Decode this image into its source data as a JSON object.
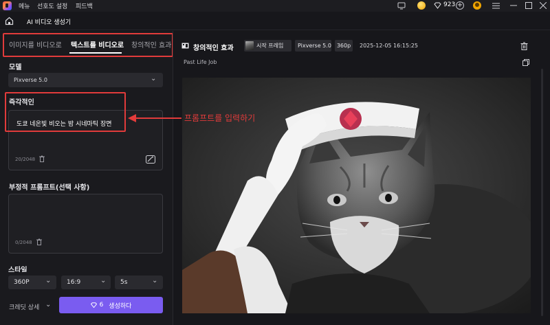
{
  "topbar": {
    "menu": "메뉴",
    "preferences": "선호도 설정",
    "feedback": "피드백",
    "credits": "923"
  },
  "header": {
    "title": "AI 비디오 생성기"
  },
  "left": {
    "tabs": [
      {
        "label": "이미지를 비디오로",
        "active": false
      },
      {
        "label": "텍스트를 비디오로",
        "active": true
      },
      {
        "label": "창의적인 효과",
        "active": false
      }
    ],
    "model_label": "모델",
    "model_value": "Pixverse 5.0",
    "prompt_label": "즉각적인",
    "prompt_text": "도쿄 네온빛 비오는 밤 시네마틱 장면",
    "prompt_count": "20/2048",
    "negative_label": "부정적 프롬프트(선택 사항)",
    "negative_count": "0/2048",
    "style_label": "스타일",
    "options": {
      "resolution": "360P",
      "aspect": "16:9",
      "duration": "5s"
    },
    "credit_detail": "크레딧 상세",
    "generate_cost": "6",
    "generate_label": "생성하다"
  },
  "annotation": {
    "text": "프롬프트를 입력하기",
    "color": "#e23b3b"
  },
  "result": {
    "title": "창의적인 효과",
    "start_frame_label": "시작 프레임",
    "model_chip": "Pixverse 5.0",
    "res_chip": "360p",
    "timestamp": "2025-12-05 16:15:25",
    "caption": "Past Life Job"
  },
  "colors": {
    "accent": "#7a5cf0",
    "highlight": "#e23b3b"
  }
}
